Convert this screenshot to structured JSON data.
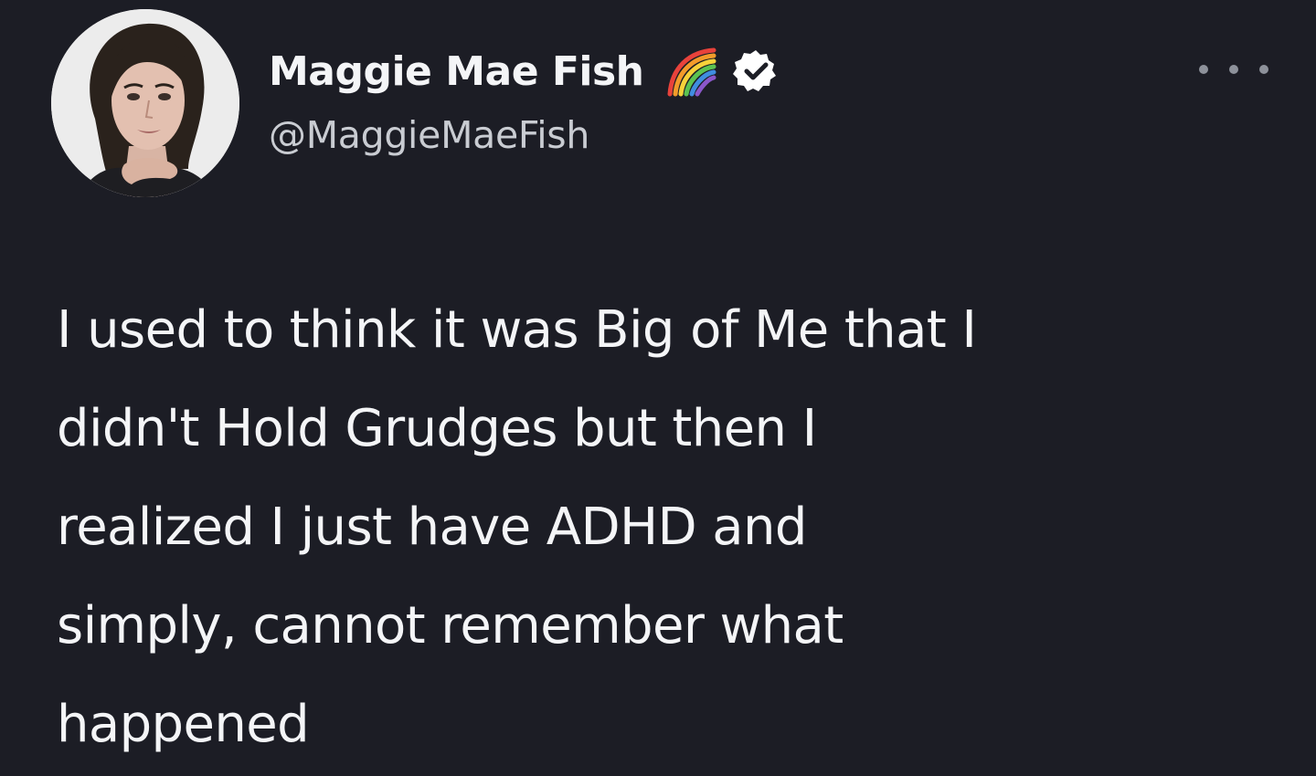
{
  "author": {
    "display_name": "Maggie Mae Fish",
    "handle": "@MaggieMaeFish",
    "badge_icon": "rainbow-icon",
    "verified_icon": "verified-badge-icon",
    "avatar_icon": "profile-photo"
  },
  "menu": {
    "icon": "more-options-icon"
  },
  "tweet": {
    "text": "I used to think it was Big of Me that I\ndidn't Hold Grudges but then I\nrealized I just have ADHD and\nsimply, cannot remember what\nhappened"
  },
  "colors": {
    "background": "#1c1d25",
    "text": "#f4f5f7",
    "secondary_text": "#c9ccd2"
  }
}
